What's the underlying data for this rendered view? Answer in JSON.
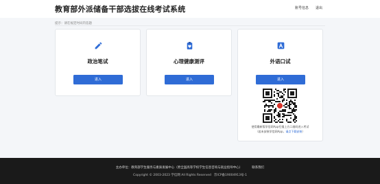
{
  "header": {
    "title": "教育部外派储备干部选拔在线考试系统",
    "account_label": "账号信息",
    "logout_label": "退出"
  },
  "notice": "提示：请在规定时间内答题",
  "cards": [
    {
      "title": "政治笔试",
      "button_label": "进入",
      "icon": "pencil-icon"
    },
    {
      "title": "心理健康测评",
      "button_label": "进入",
      "icon": "clipboard-heart-icon"
    },
    {
      "title": "外语口试",
      "button_label": "进入",
      "icon": "letter-a-icon"
    }
  ],
  "qr": {
    "line1": "使用最新版学信网App扫描上方二维码进入考试",
    "line2_prefix": "（若未安装学信网App，",
    "line2_link": "请点下载安装",
    "line2_suffix": "）"
  },
  "footer": {
    "organizer": "主办单位：教育部学生服务与素质发展中心（原全国高等学校学生信息咨询与就业指导中心）",
    "contact_label": "联系我们",
    "copyright": "Copyright © 2003-2023 学信网 All Rights Reserved",
    "icp": "京ICP备19004913号-1"
  },
  "colors": {
    "accent": "#2f6cd6",
    "footer_bg": "#1a1a1a"
  }
}
